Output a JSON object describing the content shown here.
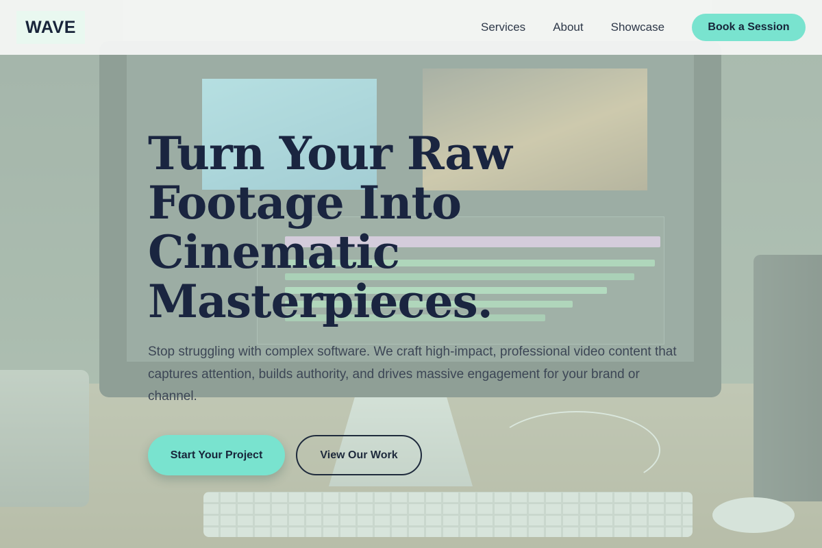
{
  "header": {
    "logo_text": "WAVE",
    "nav": [
      {
        "label": "Services"
      },
      {
        "label": "About"
      },
      {
        "label": "Showcase"
      }
    ],
    "cta_label": "Book a Session"
  },
  "hero": {
    "title": "Turn Your Raw Footage Into Cinematic Masterpieces.",
    "subtitle": "Stop struggling with complex software. We craft high-impact, professional video content that captures attention, builds authority, and drives massive engagement for your brand or channel.",
    "primary_button": "Start Your Project",
    "secondary_button": "View Our Work"
  },
  "colors": {
    "accent": "#79e3cf",
    "heading": "#1a2540",
    "body_text": "#3c4655",
    "header_bg": "#f6f8f6"
  },
  "background_image": "video-editing-workstation-photo"
}
